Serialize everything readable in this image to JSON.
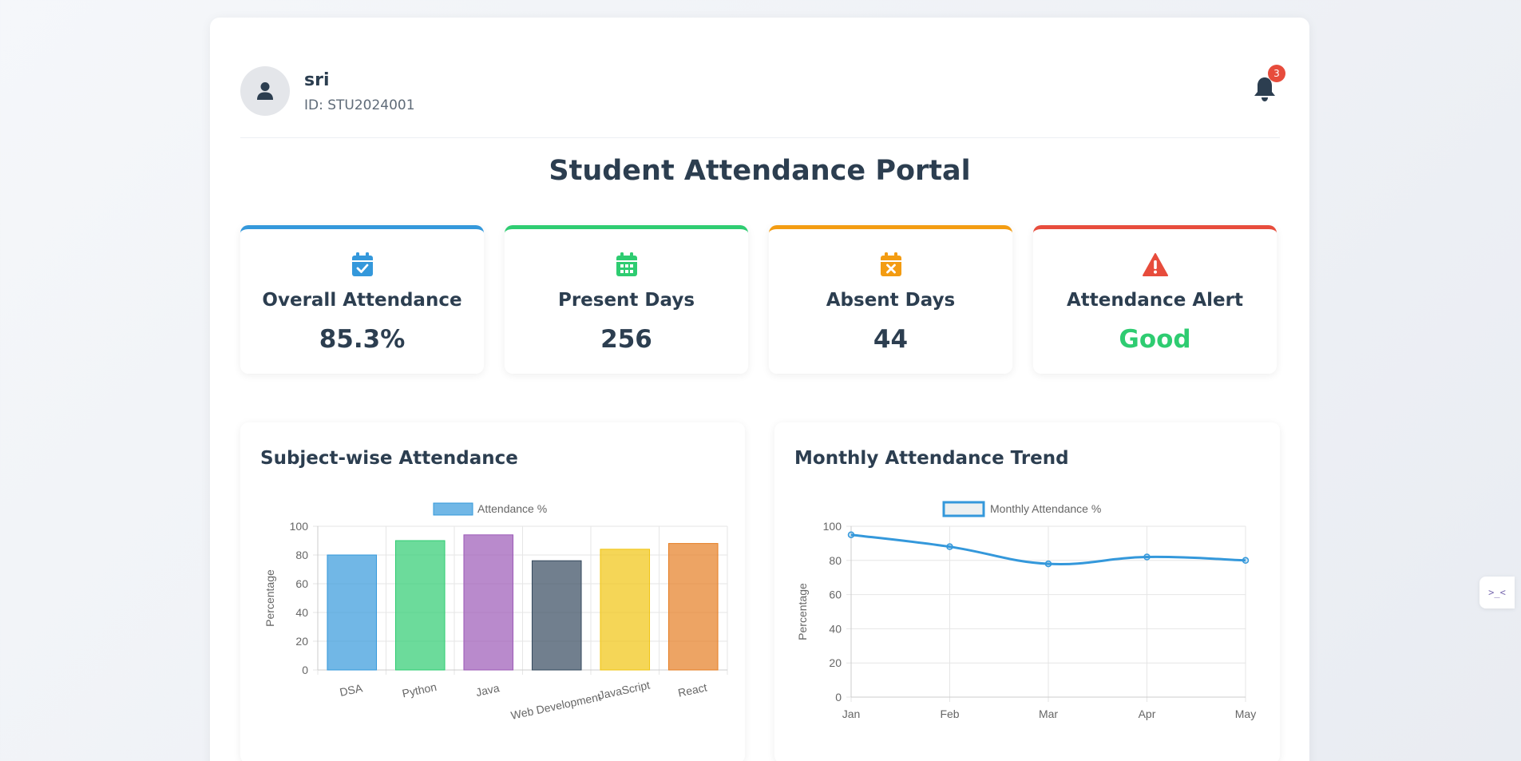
{
  "user": {
    "name": "sri",
    "id_text": "ID: STU2024001"
  },
  "notifications": {
    "count": "3"
  },
  "page_title": "Student Attendance Portal",
  "cards": [
    {
      "label": "Overall Attendance",
      "value": "85.3%",
      "accent": "#3498db",
      "value_color": "#2c3e50",
      "icon": "calendar-check-icon"
    },
    {
      "label": "Present Days",
      "value": "256",
      "accent": "#2ecc71",
      "value_color": "#2c3e50",
      "icon": "calendar-grid-icon"
    },
    {
      "label": "Absent Days",
      "value": "44",
      "accent": "#f39c12",
      "value_color": "#2c3e50",
      "icon": "calendar-x-icon"
    },
    {
      "label": "Attendance Alert",
      "value": "Good",
      "accent": "#e74c3c",
      "value_color": "#2ecc71",
      "icon": "warning-icon"
    }
  ],
  "side_widget": {
    "label": ">_<"
  },
  "chart_data": [
    {
      "type": "bar",
      "title": "Subject-wise Attendance",
      "legend": "Attendance %",
      "ylabel": "Percentage",
      "ylim": [
        0,
        100
      ],
      "yticks": [
        "0",
        "20",
        "40",
        "60",
        "80",
        "100"
      ],
      "categories": [
        "DSA",
        "Python",
        "Java",
        "Web Development",
        "JavaScript",
        "React"
      ],
      "values": [
        80,
        90,
        94,
        76,
        84,
        88
      ],
      "colors": [
        "#3498db",
        "#2ecc71",
        "#9b59b6",
        "#34495e",
        "#f1c40f",
        "#e67e22"
      ],
      "grid": true,
      "legend_position": "top"
    },
    {
      "type": "line",
      "title": "Monthly Attendance Trend",
      "legend": "Monthly Attendance %",
      "ylabel": "Percentage",
      "ylim": [
        0,
        100
      ],
      "yticks": [
        "0",
        "20",
        "40",
        "60",
        "80",
        "100"
      ],
      "categories": [
        "Jan",
        "Feb",
        "Mar",
        "Apr",
        "May"
      ],
      "values": [
        95,
        88,
        78,
        82,
        80
      ],
      "color": "#3498db",
      "grid": true,
      "legend_position": "top"
    }
  ]
}
